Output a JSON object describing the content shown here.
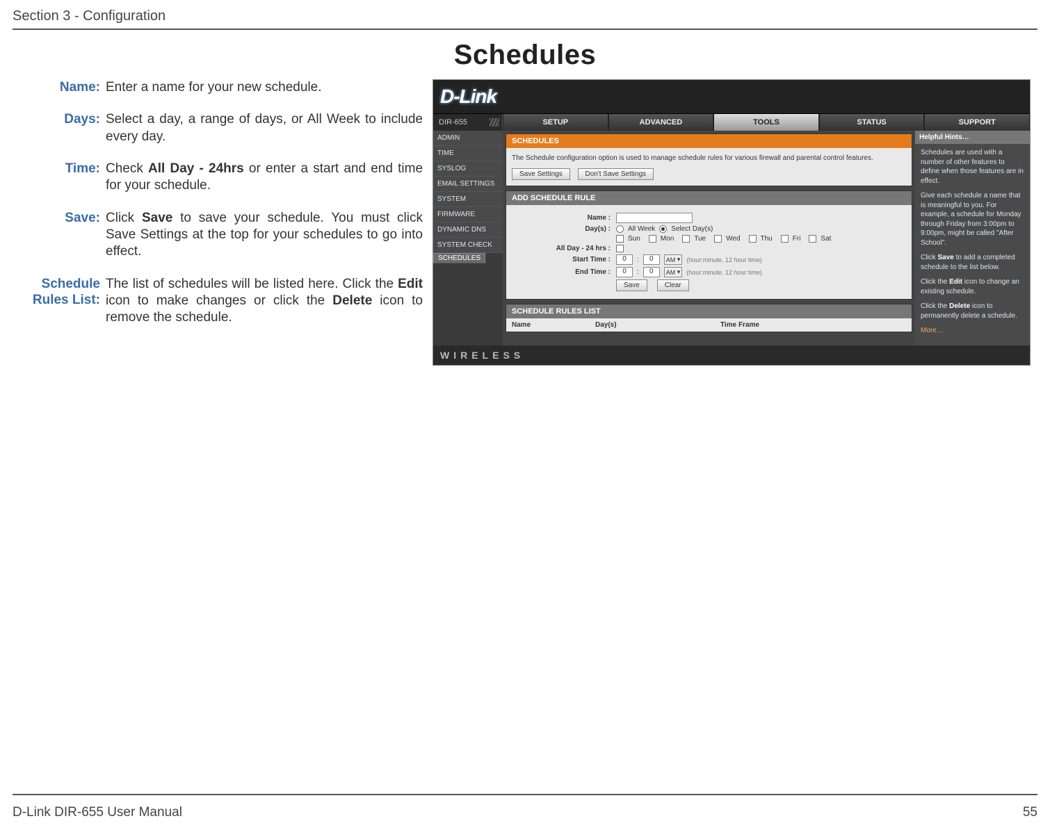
{
  "header": {
    "section": "Section 3 - Configuration"
  },
  "title": "Schedules",
  "defs": [
    {
      "label": "Name:",
      "html": "Enter a name for your new schedule."
    },
    {
      "label": "Days:",
      "html": "Select a day, a range of days, or All Week to include every day."
    },
    {
      "label": "Time:",
      "html": "Check <b>All Day - 24hrs</b> or enter a start and end time for your schedule."
    },
    {
      "label": "Save:",
      "html": "Click <b>Save</b> to save your schedule. You must click Save Settings at the top for your schedules to go into effect."
    },
    {
      "label": "Schedule Rules List:",
      "html": "The list of schedules will be listed here. Click the <b>Edit</b> icon to make changes or click the <b>Delete</b> icon to remove the schedule."
    }
  ],
  "shot": {
    "logo": "D-Link",
    "model": "DIR-655",
    "tabs": [
      "SETUP",
      "ADVANCED",
      "TOOLS",
      "STATUS",
      "SUPPORT"
    ],
    "active_tab": 2,
    "leftnav": [
      "ADMIN",
      "TIME",
      "SYSLOG",
      "EMAIL SETTINGS",
      "SYSTEM",
      "FIRMWARE",
      "DYNAMIC DNS",
      "SYSTEM CHECK",
      "SCHEDULES"
    ],
    "leftnav_sel": 8,
    "box1": {
      "title": "SCHEDULES",
      "desc": "The Schedule configuration option is used to manage schedule rules for various firewall and parental control features.",
      "btn_save": "Save Settings",
      "btn_dont": "Don't Save Settings"
    },
    "box2": {
      "title": "ADD SCHEDULE RULE",
      "name_lbl": "Name :",
      "days_lbl": "Day(s) :",
      "allweek": "All Week",
      "selectdays": "Select Day(s)",
      "day_names": [
        "Sun",
        "Mon",
        "Tue",
        "Wed",
        "Thu",
        "Fri",
        "Sat"
      ],
      "allday_lbl": "All Day - 24 hrs :",
      "start_lbl": "Start Time :",
      "end_lbl": "End Time :",
      "time_val": "0",
      "ampm": "AM",
      "time_hint": "(hour:minute, 12 hour time)",
      "btn_save": "Save",
      "btn_clear": "Clear"
    },
    "box3": {
      "title": "SCHEDULE RULES LIST",
      "cols": [
        "Name",
        "Day(s)",
        "Time Frame"
      ]
    },
    "hints": {
      "title": "Helpful Hints…",
      "p1": "Schedules are used with a number of other features to define when those features are in effect.",
      "p2a": "Give each schedule a name that is meaningful to you. For example, a schedule for Monday through Friday from 3:00pm to 9:00pm, might be called \"After School\".",
      "p3a": "Click ",
      "p3b": "Save",
      "p3c": " to add a completed schedule to the list below.",
      "p4a": "Click the ",
      "p4b": "Edit",
      "p4c": " icon to change an existing schedule.",
      "p5a": "Click the ",
      "p5b": "Delete",
      "p5c": " icon to permanently delete a schedule.",
      "more": "More…"
    },
    "wireless": "WIRELESS"
  },
  "footer": {
    "left": "D-Link DIR-655 User Manual",
    "right": "55"
  }
}
